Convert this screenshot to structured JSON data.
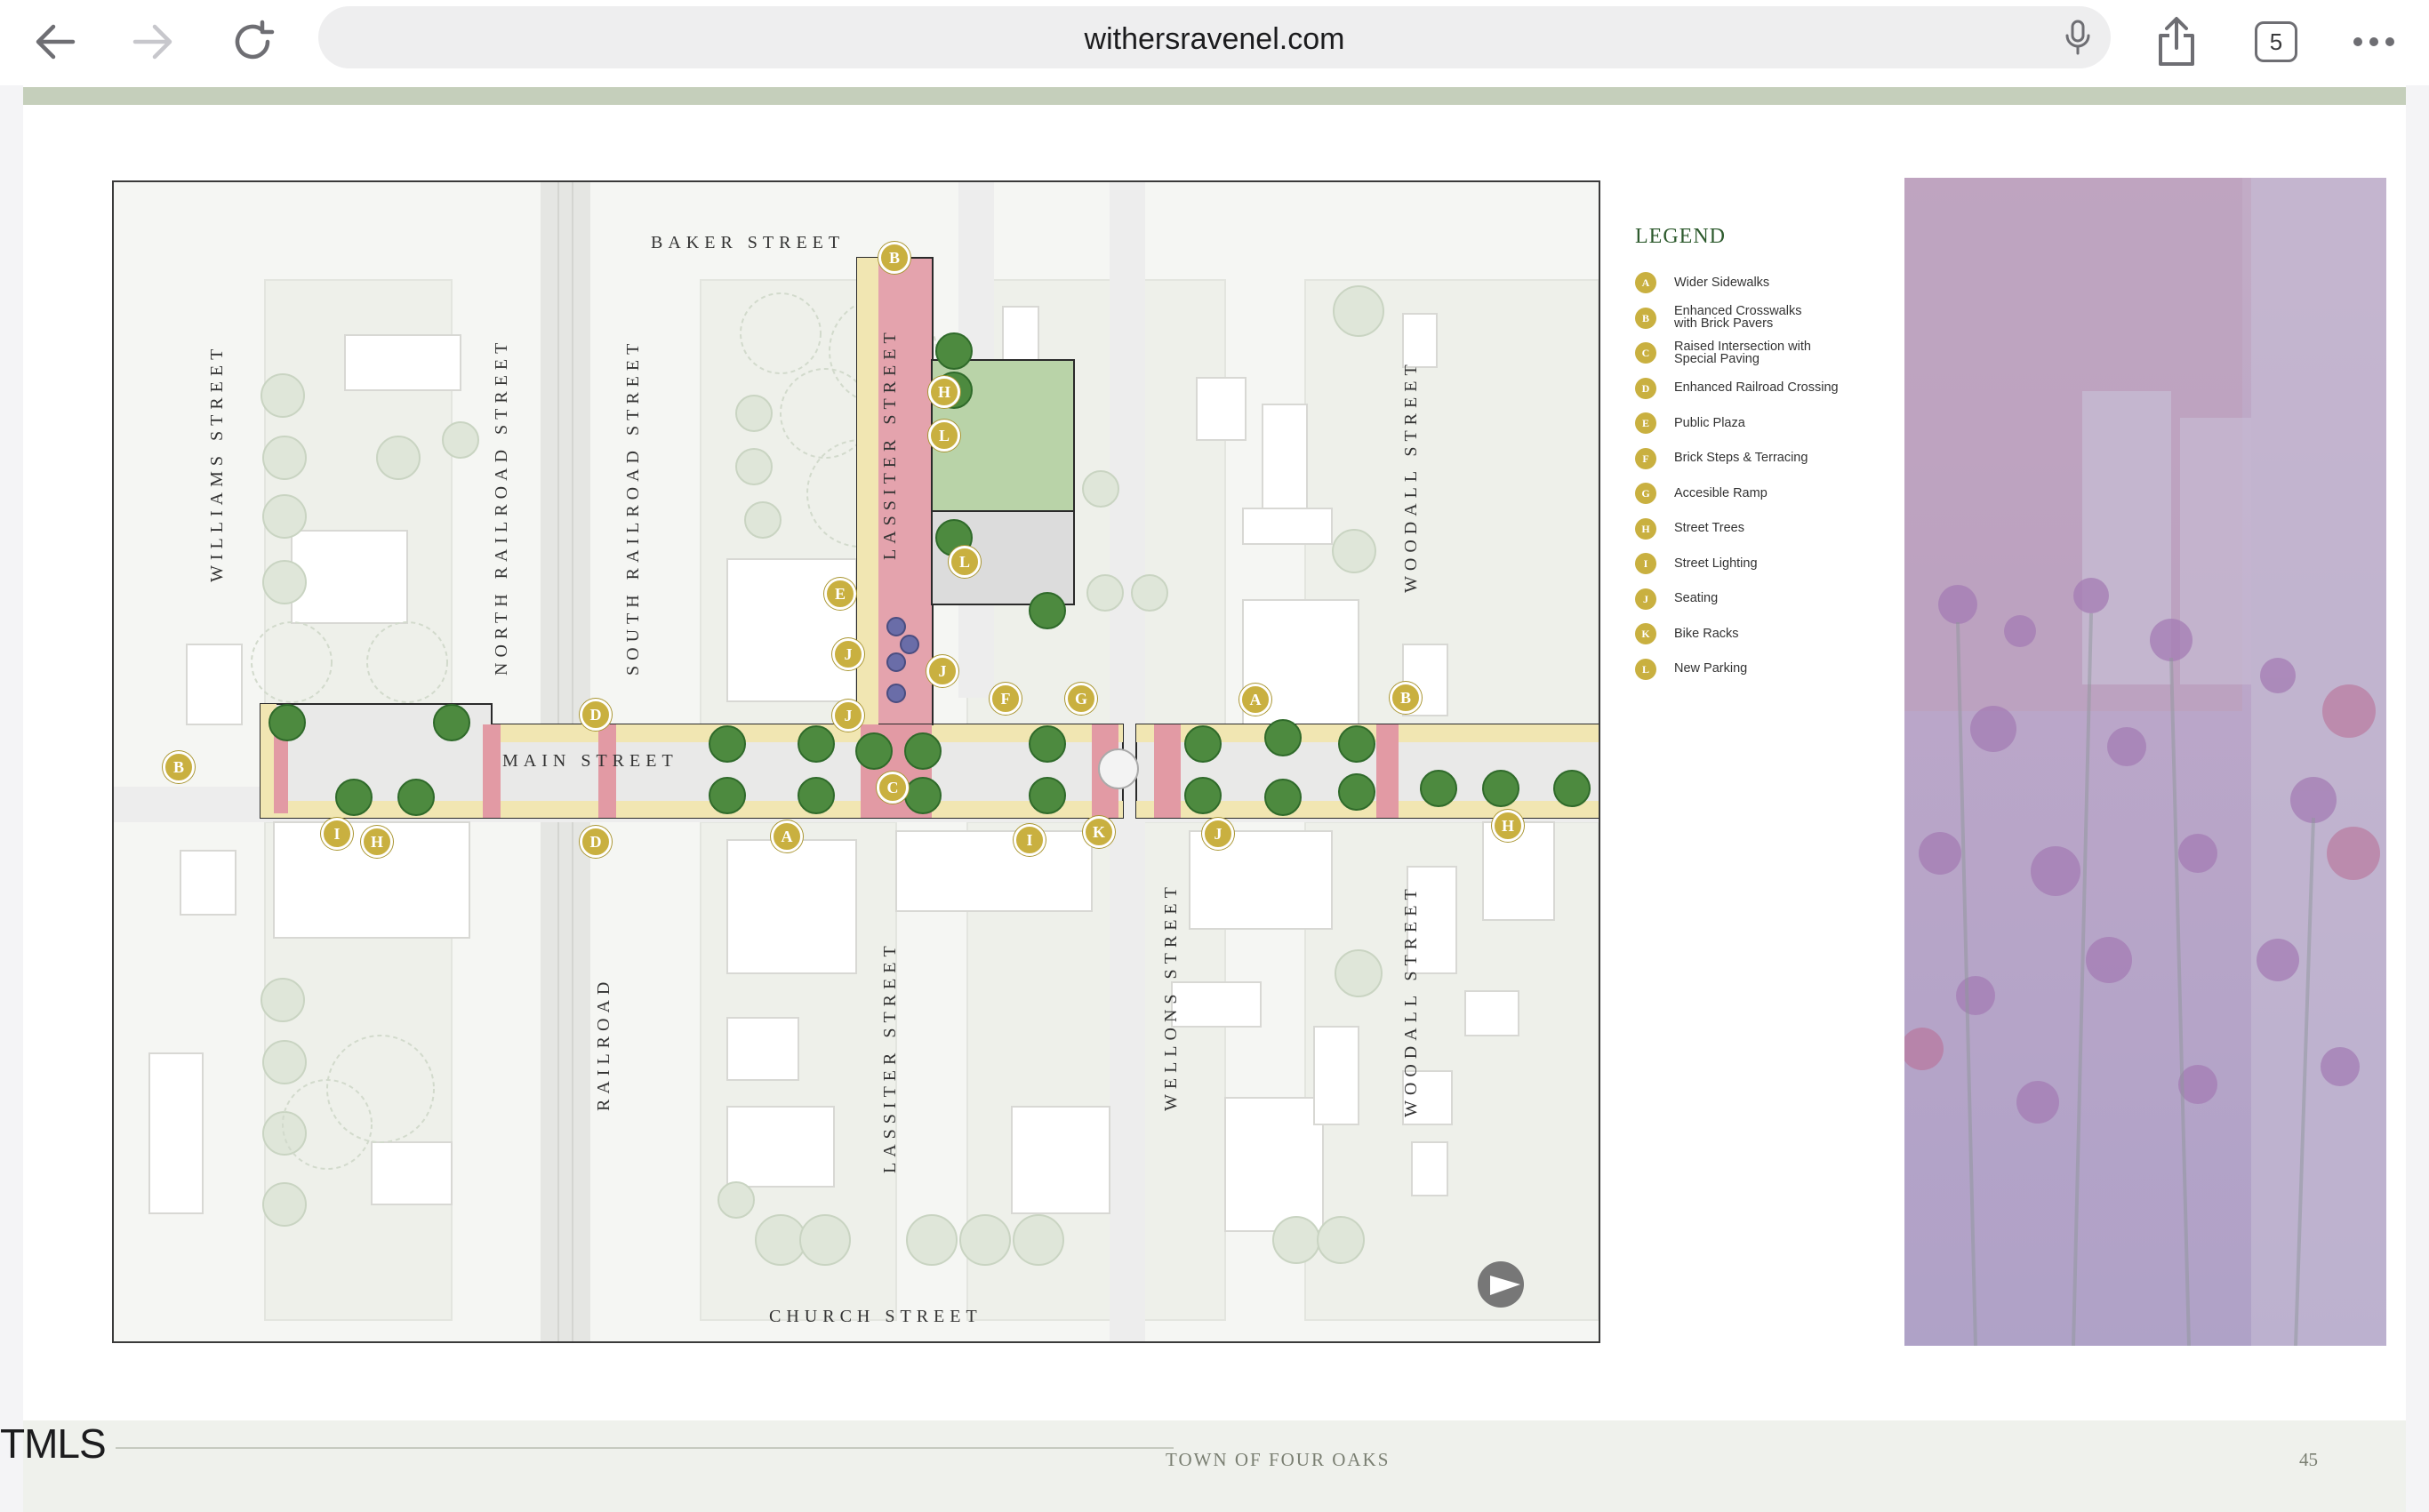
{
  "browser": {
    "url": "withersravenel.com",
    "tab_count": "5"
  },
  "map": {
    "streets": {
      "baker": "BAKER STREET",
      "church": "CHURCH STREET",
      "main": "MAIN STREET",
      "williams": "WILLIAMS STREET",
      "north_railroad": "NORTH RAILROAD STREET",
      "south_railroad": "SOUTH RAILROAD STREET",
      "lassiter_north": "LASSITER STREET",
      "lassiter_south": "LASSITER STREET",
      "woodall_north": "WOODALL STREET",
      "woodall_south": "WOODALL STREET",
      "wellons": "WELLONS STREET",
      "railroad": "RAILROAD"
    },
    "markers": [
      "B",
      "H",
      "L",
      "L",
      "E",
      "J",
      "J",
      "D",
      "F",
      "G",
      "A",
      "B",
      "B",
      "I",
      "H",
      "D",
      "A",
      "J",
      "C",
      "I",
      "K",
      "J",
      "H"
    ]
  },
  "legend": {
    "title": "LEGEND",
    "items": [
      {
        "key": "A",
        "label": "Wider Sidewalks"
      },
      {
        "key": "B",
        "label": "Enhanced Crosswalks with Brick Pavers"
      },
      {
        "key": "C",
        "label": "Raised Intersection with Special Paving"
      },
      {
        "key": "D",
        "label": "Enhanced Railroad Crossing"
      },
      {
        "key": "E",
        "label": "Public Plaza"
      },
      {
        "key": "F",
        "label": "Brick Steps & Terracing"
      },
      {
        "key": "G",
        "label": "Accesible Ramp"
      },
      {
        "key": "H",
        "label": "Street Trees"
      },
      {
        "key": "I",
        "label": "Street Lighting"
      },
      {
        "key": "J",
        "label": "Seating"
      },
      {
        "key": "K",
        "label": "Bike Racks"
      },
      {
        "key": "L",
        "label": "New Parking"
      }
    ]
  },
  "footer": {
    "title": "TOWN OF FOUR OAKS",
    "page_number": "45",
    "watermark": "TMLS"
  },
  "colors": {
    "marker": "#c9b040",
    "legend_title": "#2d5a2d",
    "photo_tint": "#c8b8d4"
  }
}
